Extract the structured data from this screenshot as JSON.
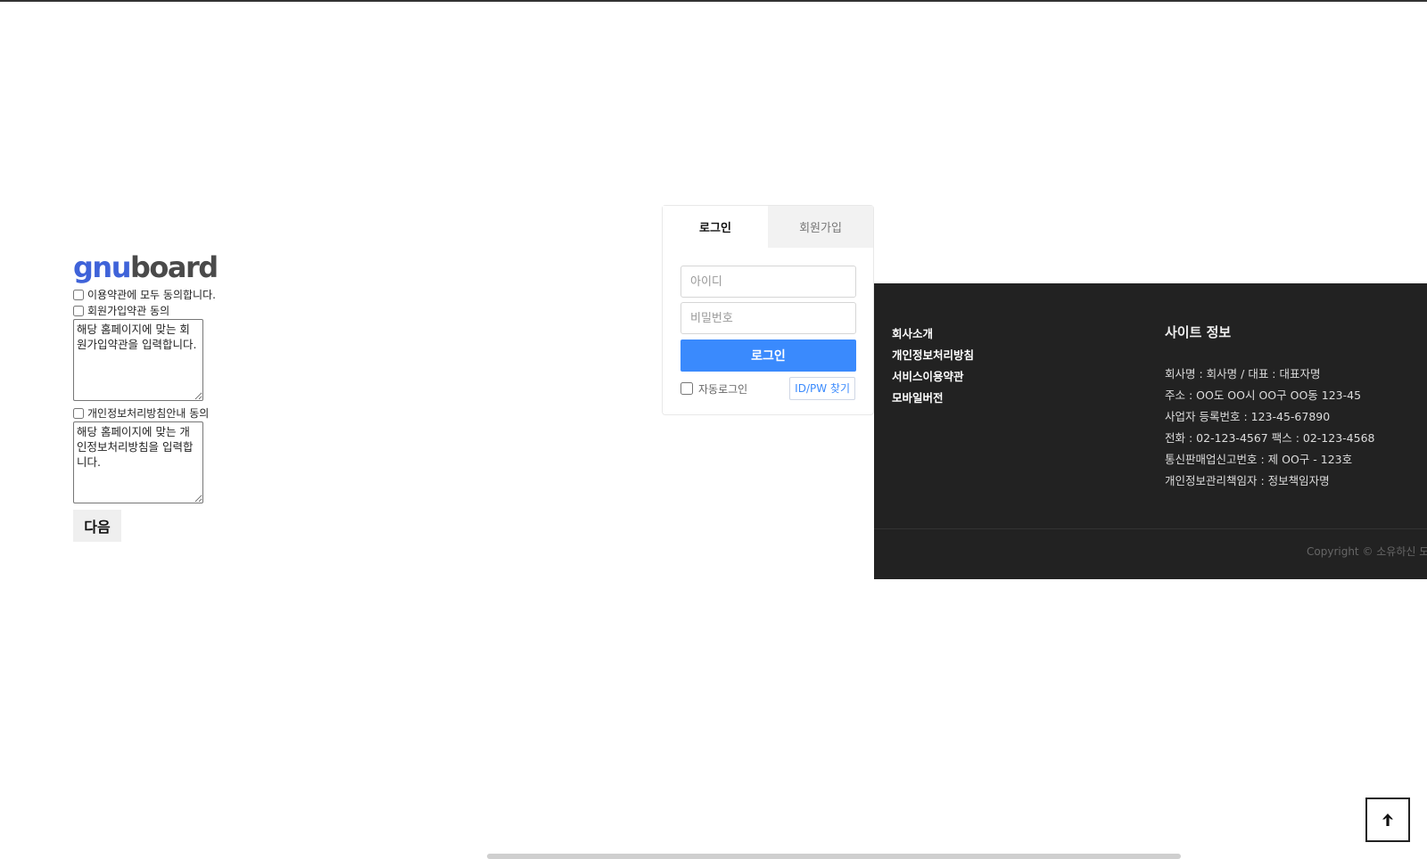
{
  "register": {
    "logo": {
      "gnu": "gnu",
      "board": "board"
    },
    "agree_all_label": "이용약관에 모두 동의합니다.",
    "membership": {
      "label": "회원가입약관 동의",
      "text": "해당 홈페이지에 맞는 회원가입약관을 입력합니다."
    },
    "privacy": {
      "label": "개인정보처리방침안내 동의",
      "text": "해당 홈페이지에 맞는 개인정보처리방침을 입력합니다."
    },
    "next_label": "다음"
  },
  "login": {
    "tabs": [
      {
        "label": "로그인",
        "active": true
      },
      {
        "label": "회원가입",
        "active": false
      }
    ],
    "id_placeholder": "아이디",
    "pw_placeholder": "비밀번호",
    "submit_label": "로그인",
    "auto_login_label": "자동로그인",
    "find_label": "ID/PW 찾기",
    "accent_color": "#3a8afd"
  },
  "footer": {
    "links": [
      "회사소개",
      "개인정보처리방침",
      "서비스이용약관",
      "모바일버전"
    ],
    "site_info": {
      "title": "사이트 정보",
      "lines": [
        "회사명 : 회사명 / 대표 : 대표자명",
        "주소 : OO도 OO시 OO구 OO동 123-45",
        "사업자 등록번호 : 123-45-67890",
        "전화 : 02-123-4567 팩스 : 02-123-4568",
        "통신판매업신고번호 : 제 OO구 - 123호",
        "개인정보관리책임자 : 정보책임자명"
      ]
    },
    "copyright": "Copyright © 소유하신 도메",
    "background_color": "#222222"
  },
  "to_top": {
    "icon": "arrow-up-icon"
  }
}
